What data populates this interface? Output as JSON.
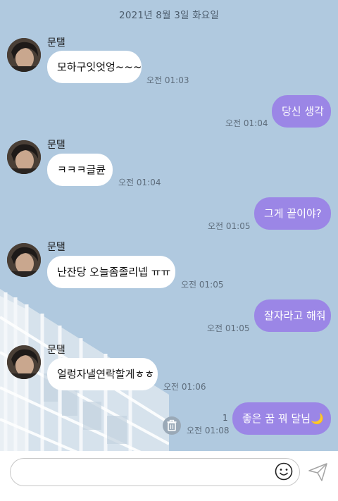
{
  "date_separator": "2021년 8월 3일 화요일",
  "sender_name": "문탤",
  "messages": [
    {
      "text": "모하구잇엇엉~~~",
      "time": "오전 01:03"
    },
    {
      "text": "당신 생각",
      "time": "오전 01:04"
    },
    {
      "text": "ㅋㅋㅋ글큔",
      "time": "오전 01:04"
    },
    {
      "text": "그게 끝이야?",
      "time": "오전 01:05"
    },
    {
      "text": "난잔당 오늘좀졸리넵 ㅠㅠ",
      "time": "오전 01:05"
    },
    {
      "text": "잘자라고 해줘",
      "time": "오전 01:05"
    },
    {
      "text": "얼렁자낼연락할게ㅎㅎ",
      "time": "오전 01:06"
    },
    {
      "text": "좋은 꿈 꿔 달님🌙",
      "time": "오전 01:08",
      "unread": "1"
    }
  ],
  "input": {
    "placeholder": ""
  },
  "colors": {
    "background": "#b0c9df",
    "outgoing_bubble": "#9b86e6",
    "incoming_bubble": "#ffffff"
  },
  "icons": [
    "trash-icon",
    "emoji-icon",
    "send-icon"
  ]
}
